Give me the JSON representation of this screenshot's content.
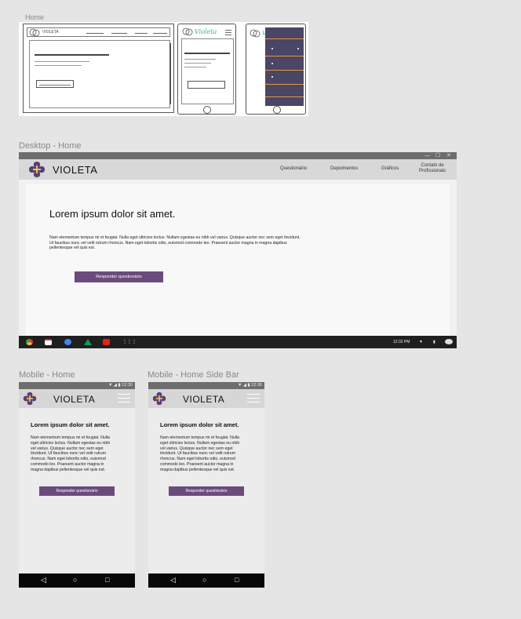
{
  "frames": {
    "home": "Home",
    "desktop": "Desktop - Home",
    "mobile": "Mobile - Home",
    "mobile_sidebar": "Mobile - Home Side Bar"
  },
  "brand": {
    "name": "VIOLETA",
    "color_primary": "#6b4b7c",
    "logo_color": "#e8c46b"
  },
  "desktop": {
    "nav": [
      "Questionário",
      "Depoimentos",
      "Gráficos",
      "Contato de",
      "Profissionais"
    ],
    "headline": "Lorem ipsum dolor sit amet.",
    "paragraph_lines": [
      "Nam elementum tempus mi et feugiat. Nulla eget ultricies lectus. Nullam egestas eu nibh vel varius. Quisque auctor nec sem eget tincidunt.",
      "Ut faucibus nunc vel velit rutrum rhoncus. Nam eget lobortis odio, euismod commodo leo. Praesent auctor magna in magna dapibus",
      "pellentesque vel quis est."
    ],
    "cta": "Responder questionário",
    "clock": "12:32 PM",
    "window_controls": [
      "—",
      "☐",
      "✕"
    ]
  },
  "mobile": {
    "status": "▼ ◢ ▮ 12:30",
    "headline": "Lorem ipsum dolor sit amet.",
    "paragraph_lines": [
      "Nam elementum tempus mi et feugiat. Nulla",
      "eget ultricies lectus. Nullam egestas eu nibh",
      "vel varius. Quisque auctor nec sem eget",
      "tincidunt. Ut faucibus nunc vel velit rutrum",
      "rhoncus. Nam eget lobortis odio, euismod",
      "commodo leo. Praesent auctor magna in",
      "magna dapibus pellentesque vel quis est."
    ],
    "cta": "Responder questionário",
    "nav_buttons": [
      "◁",
      "○",
      "□"
    ]
  },
  "sketch": {
    "brand": "VIOLETA",
    "brand_script": "Violeta"
  }
}
